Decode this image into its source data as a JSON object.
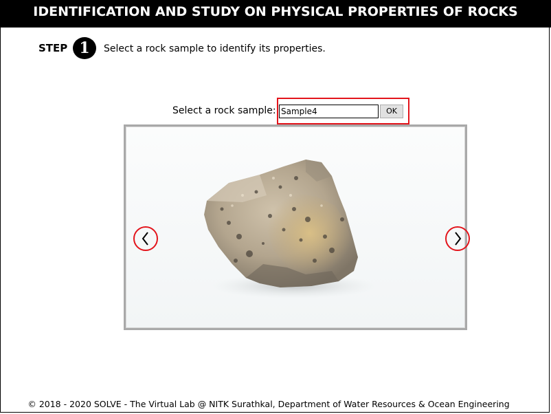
{
  "header": {
    "title": "IDENTIFICATION AND STUDY ON PHYSICAL PROPERTIES OF ROCKS"
  },
  "step": {
    "label": "STEP",
    "number": "1",
    "instruction": "Select a rock sample to identify its properties."
  },
  "sample_selector": {
    "label": "Select a rock sample:",
    "value": "Sample4",
    "ok_label": "OK",
    "highlight_color": "#e3141b"
  },
  "viewer": {
    "image_description_icon": "rock-photo",
    "prev_icon": "chevron-left-icon",
    "next_icon": "chevron-right-icon"
  },
  "footer": {
    "text": "© 2018 - 2020 SOLVE - The Virtual Lab @ NITK Surathkal, Department of Water Resources & Ocean Engineering"
  },
  "colors": {
    "title_bar_bg": "#000000",
    "title_bar_text": "#ffffff",
    "accent_red": "#e3141b",
    "viewer_border": "#a9a9a9"
  }
}
